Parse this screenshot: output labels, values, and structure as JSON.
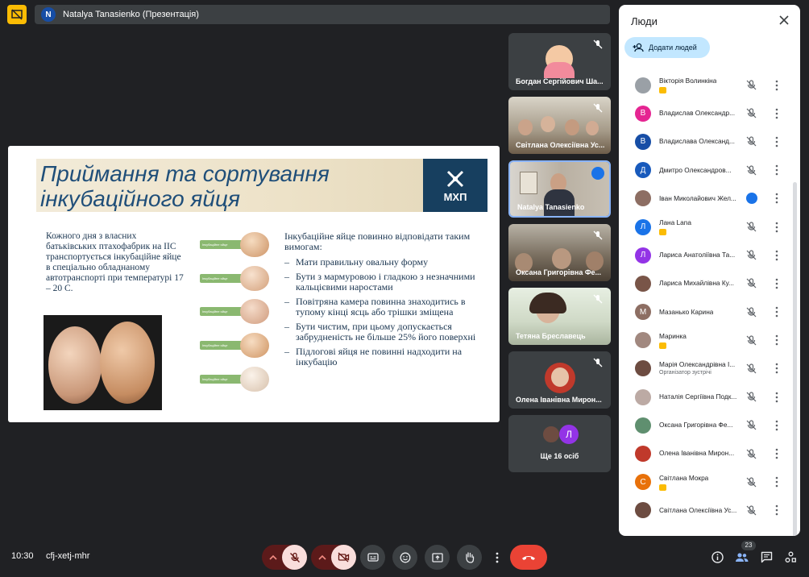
{
  "header": {
    "presenter_title": "Natalya Tanasienko (Презентація)",
    "avatar_letter": "N"
  },
  "slide": {
    "title_line1": "Приймання та сортування",
    "title_line2": "інкубаційного яйця",
    "logo": "МХП",
    "left_text": "Кожного дня з власних батьківських птахофабрик на ІІС транспортується інкубаційне яйце в спеціально обладнаному автотранспорті при температурі 17 – 20 С.",
    "egg_tag": "Інкубаційне яйце",
    "right_intro": "Інкубаційне яйце повинно відповідати таким вимогам:",
    "bullets": [
      "Мати правильну овальну форму",
      "Бути з мармуровою і гладкою з незначними кальцієвими наростами",
      "Повітряна камера повинна знаходитись в тупому кінці ясць або трішки зміщена",
      "Бути чистим, при цьому допускається забрудненість не більше 25% його поверхні",
      "Підлогові яйця не повинні надходити на інкубацію"
    ]
  },
  "tiles": [
    {
      "name": "Богдан Сергійович Ша..."
    },
    {
      "name": "Світлана Олексіївна Ус..."
    },
    {
      "name": "Natalya Tanasienko"
    },
    {
      "name": "Оксана Григорівна Фе..."
    },
    {
      "name": "Тетяна Бреславець"
    },
    {
      "name": "Олена Іванівна Мирон..."
    },
    {
      "name": "Ще 16 осіб",
      "avatar_letter": "Л"
    }
  ],
  "panel": {
    "title": "Люди",
    "add_label": "Додати людей",
    "people": [
      {
        "name": "Вікторія Волинкіна",
        "avatar": "",
        "color": "#9aa0a6",
        "badge": true
      },
      {
        "name": "Владислав Олександр...",
        "avatar": "В",
        "color": "#e52592"
      },
      {
        "name": "Владислава Олександ...",
        "avatar": "В",
        "color": "#174ea6"
      },
      {
        "name": "Дмитро Олександров...",
        "avatar": "Д",
        "color": "#185abc"
      },
      {
        "name": "Іван Миколайович Жел...",
        "avatar": "",
        "color": "#8d6e63",
        "active": true
      },
      {
        "name": "Лана Lana",
        "avatar": "Л",
        "color": "#1a73e8",
        "badge": true
      },
      {
        "name": "Лариса Анатоліївна Та...",
        "avatar": "Л",
        "color": "#9334e6"
      },
      {
        "name": "Лариса Михайлівна Ку...",
        "avatar": "",
        "color": "#795548"
      },
      {
        "name": "Мазанько Карина",
        "avatar": "М",
        "color": "#8d6e63"
      },
      {
        "name": "Маринка",
        "avatar": "",
        "color": "#a1887f",
        "badge": true
      },
      {
        "name": "Марія Олександрівна І...",
        "sub": "Організатор зустрічі",
        "avatar": "",
        "color": "#6d4c41"
      },
      {
        "name": "Наталія Сергіївна Подк...",
        "avatar": "",
        "color": "#bcaaa4"
      },
      {
        "name": "Оксана Григорівна Фе...",
        "avatar": "",
        "color": "#5f8f6f"
      },
      {
        "name": "Олена Іванівна Мирон...",
        "avatar": "",
        "color": "#c0392b"
      },
      {
        "name": "Світлана Мокра",
        "avatar": "С",
        "color": "#e8710a",
        "badge": true
      },
      {
        "name": "Світлана Олексіївна Ус...",
        "avatar": "",
        "color": "#6d4c41"
      }
    ]
  },
  "bottom": {
    "time": "10:30",
    "meeting_code": "cfj-xetj-mhr",
    "people_count": "23"
  },
  "colors": {
    "background": "#202124",
    "end_call": "#ea4335",
    "muted": "#f9dedc",
    "accent": "#c2e7ff"
  }
}
